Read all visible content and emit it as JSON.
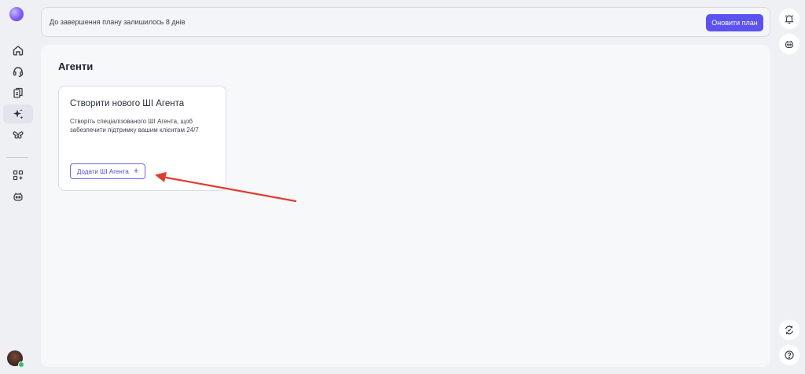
{
  "banner": {
    "text": "До завершення плану залишилось 8 днів",
    "upgrade_label": "Оновити план"
  },
  "sidebar": {
    "items": [
      {
        "name": "home",
        "icon": "home-icon"
      },
      {
        "name": "support",
        "icon": "headset-icon"
      },
      {
        "name": "documents",
        "icon": "documents-icon"
      },
      {
        "name": "ai-agents",
        "icon": "sparkles-icon",
        "active": true
      },
      {
        "name": "integrations",
        "icon": "butterfly-icon"
      },
      {
        "name": "apps",
        "icon": "apps-add-icon"
      },
      {
        "name": "bot",
        "icon": "bot-icon"
      }
    ]
  },
  "main": {
    "title": "Агенти",
    "card": {
      "title": "Створити нового ШІ Агента",
      "description": "Створіть спеціалізованого ШІ Агента, щоб забезпечити підтримку вашим клієнтам 24/7",
      "button_label": "Додати ШІ Агента"
    }
  },
  "colors": {
    "accent": "#5b52f0",
    "annotation_arrow": "#e23b2e"
  }
}
